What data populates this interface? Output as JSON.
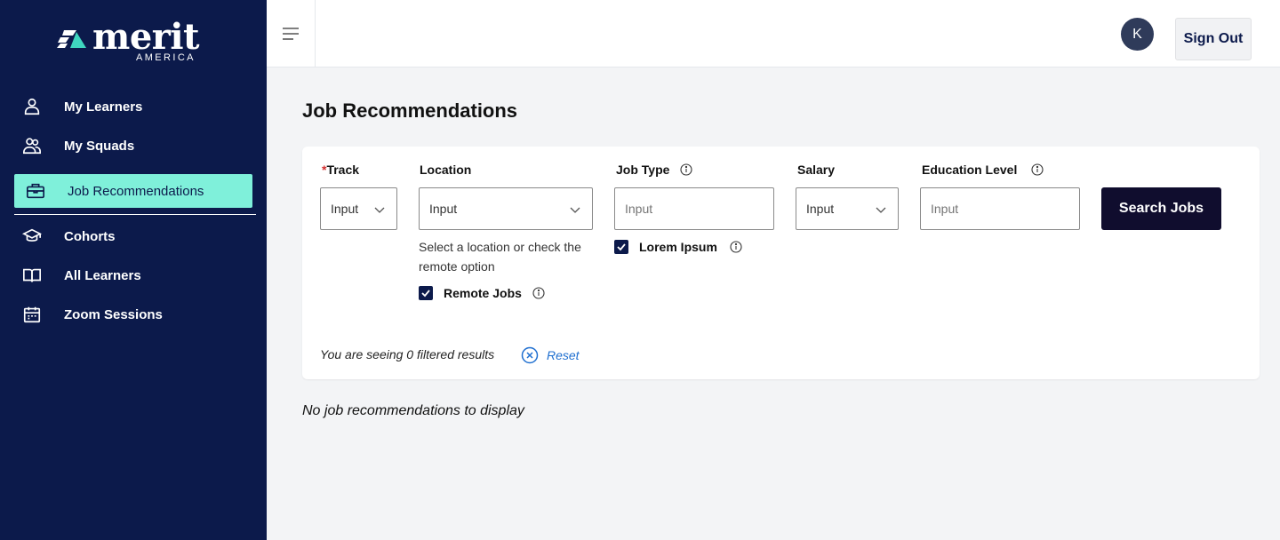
{
  "brand": {
    "name": "merit",
    "subtitle": "AMERICA"
  },
  "sidebar": {
    "items": [
      {
        "label": "My Learners",
        "icon": "user-icon"
      },
      {
        "label": "My Squads",
        "icon": "users-icon"
      },
      {
        "label": "Job Recommendations",
        "icon": "briefcase-icon",
        "active": true
      },
      {
        "label": "Cohorts",
        "icon": "graduation-cap-icon"
      },
      {
        "label": "All Learners",
        "icon": "book-open-icon"
      },
      {
        "label": "Zoom Sessions",
        "icon": "calendar-icon"
      }
    ]
  },
  "header": {
    "avatar_initial": "K",
    "signout_label": "Sign Out"
  },
  "main": {
    "title": "Job Recommendations",
    "filters": {
      "track": {
        "required_mark": "*",
        "label": "Track",
        "value": "Input"
      },
      "location": {
        "label": "Location",
        "value": "Input",
        "helper": "Select a location or check the remote option",
        "checkbox_label": "Remote Jobs",
        "checked": true
      },
      "job_type": {
        "label": "Job Type",
        "placeholder": "Input",
        "checkbox_label": "Lorem Ipsum",
        "checked": true
      },
      "salary": {
        "label": "Salary",
        "value": "Input"
      },
      "education": {
        "label": "Education Level",
        "placeholder": "Input"
      }
    },
    "search_label": "Search Jobs",
    "results_text": "You are seeing 0 filtered results",
    "reset_label": "Reset",
    "empty_text": "No job recommendations to display"
  },
  "colors": {
    "sidebar_bg": "#0c1a4b",
    "active_bg": "#7ff0da",
    "button_bg": "#100d2e",
    "link": "#1f6fd0"
  }
}
